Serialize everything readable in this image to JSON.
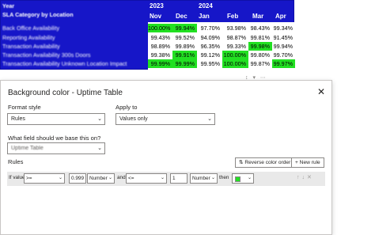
{
  "matrix": {
    "header_label_year": "Year",
    "header_label_category": "SLA Category by Location",
    "years": [
      {
        "label": "2023"
      },
      {
        "label": "2024"
      }
    ],
    "months": [
      "Nov",
      "Dec",
      "Jan",
      "Feb",
      "Mar",
      "Apr"
    ],
    "rows": [
      {
        "label": "Back Office Availability",
        "cells": [
          {
            "v": "100.00%",
            "green": true
          },
          {
            "v": "99.94%",
            "green": true
          },
          {
            "v": "97.70%",
            "green": false
          },
          {
            "v": "93.98%",
            "green": false
          },
          {
            "v": "98.43%",
            "green": false
          },
          {
            "v": "99.34%",
            "green": false
          }
        ]
      },
      {
        "label": "Reporting Availability",
        "cells": [
          {
            "v": "99.43%",
            "green": false
          },
          {
            "v": "99.52%",
            "green": false
          },
          {
            "v": "94.09%",
            "green": false
          },
          {
            "v": "98.87%",
            "green": false
          },
          {
            "v": "99.81%",
            "green": false
          },
          {
            "v": "91.45%",
            "green": false
          }
        ]
      },
      {
        "label": "Transaction Availability",
        "cells": [
          {
            "v": "98.89%",
            "green": false
          },
          {
            "v": "99.89%",
            "green": false
          },
          {
            "v": "96.35%",
            "green": false
          },
          {
            "v": "99.33%",
            "green": false
          },
          {
            "v": "99.98%",
            "green": true
          },
          {
            "v": "99.94%",
            "green": false
          }
        ]
      },
      {
        "label": "Transaction Availability 300s Doors",
        "cells": [
          {
            "v": "99.38%",
            "green": false
          },
          {
            "v": "99.91%",
            "green": true
          },
          {
            "v": "99.12%",
            "green": false
          },
          {
            "v": "100.00%",
            "green": true
          },
          {
            "v": "99.80%",
            "green": false
          },
          {
            "v": "99.70%",
            "green": false
          }
        ]
      },
      {
        "label": "Transaction Availability Unknown Location Impact",
        "cells": [
          {
            "v": "99.99%",
            "green": true
          },
          {
            "v": "99.99%",
            "green": true
          },
          {
            "v": "99.95%",
            "green": false
          },
          {
            "v": "100.00%",
            "green": true
          },
          {
            "v": "99.87%",
            "green": false
          },
          {
            "v": "99.97%",
            "green": true
          }
        ]
      }
    ]
  },
  "dialog": {
    "title": "Background color - Uptime Table",
    "format_style_label": "Format style",
    "format_style_value": "Rules",
    "apply_to_label": "Apply to",
    "apply_to_value": "Values only",
    "field_question": "What field should we base this on?",
    "field_value": "Uptime Table",
    "rules_label": "Rules",
    "reverse_button": "Reverse color order",
    "new_rule_button": "+ New rule",
    "rule": {
      "if_value": "If value",
      "operator1": ">=",
      "value1": "0.999",
      "type1": "Number",
      "and": "and",
      "operator2": "<=",
      "value2": "1",
      "type2": "Number",
      "then": "then",
      "color": "#22e022"
    }
  },
  "colors": {
    "matrix_bg": "#1616c8",
    "highlight": "#22e022"
  }
}
